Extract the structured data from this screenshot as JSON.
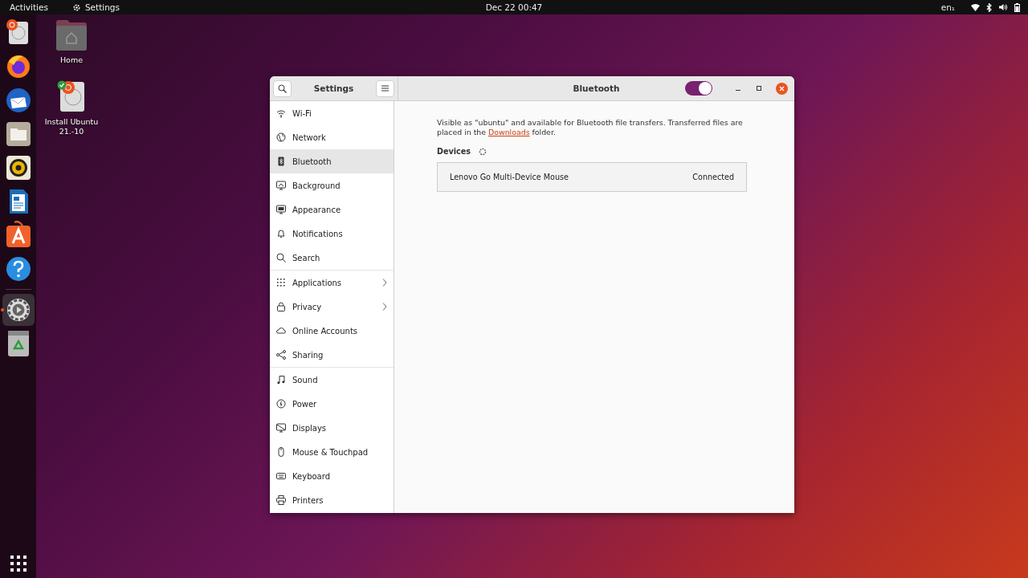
{
  "top_bar": {
    "activities": "Activities",
    "app_name": "Settings",
    "clock": "Dec 22  00:47",
    "keyboard_layout": "en₁"
  },
  "dock": {
    "items": [
      {
        "running": false
      },
      {
        "running": false
      },
      {
        "running": false
      },
      {
        "running": false
      },
      {
        "running": false
      },
      {
        "running": false
      },
      {
        "running": false
      },
      {
        "running": false
      },
      {
        "running": true
      },
      {
        "running": false
      }
    ]
  },
  "desktop_icons": [
    {
      "label": "Home"
    },
    {
      "label": "Install Ubuntu 21.-10"
    }
  ],
  "window": {
    "sidebar_title": "Settings",
    "title": "Bluetooth",
    "bluetooth_switch": {
      "on": true
    },
    "sidebar": {
      "groups": [
        [
          {
            "label": "Wi-Fi",
            "selected": false,
            "expandable": false
          },
          {
            "label": "Network",
            "selected": false,
            "expandable": false
          },
          {
            "label": "Bluetooth",
            "selected": true,
            "expandable": false
          },
          {
            "label": "Background",
            "selected": false,
            "expandable": false
          },
          {
            "label": "Appearance",
            "selected": false,
            "expandable": false
          },
          {
            "label": "Notifications",
            "selected": false,
            "expandable": false
          },
          {
            "label": "Search",
            "selected": false,
            "expandable": false
          }
        ],
        [
          {
            "label": "Applications",
            "selected": false,
            "expandable": true
          },
          {
            "label": "Privacy",
            "selected": false,
            "expandable": true
          },
          {
            "label": "Online Accounts",
            "selected": false,
            "expandable": false
          },
          {
            "label": "Sharing",
            "selected": false,
            "expandable": false
          }
        ],
        [
          {
            "label": "Sound",
            "selected": false,
            "expandable": false
          },
          {
            "label": "Power",
            "selected": false,
            "expandable": false
          },
          {
            "label": "Displays",
            "selected": false,
            "expandable": false
          },
          {
            "label": "Mouse & Touchpad",
            "selected": false,
            "expandable": false
          },
          {
            "label": "Keyboard",
            "selected": false,
            "expandable": false
          },
          {
            "label": "Printers",
            "selected": false,
            "expandable": false
          }
        ]
      ]
    },
    "description": {
      "before": "Visible as \"ubuntu\" and available for Bluetooth file transfers. Transferred files are placed in the",
      "link": "Downloads",
      "after": "folder."
    },
    "devices_heading": "Devices",
    "devices": [
      {
        "name": "Lenovo Go Multi-Device Mouse",
        "status": "Connected"
      }
    ]
  }
}
